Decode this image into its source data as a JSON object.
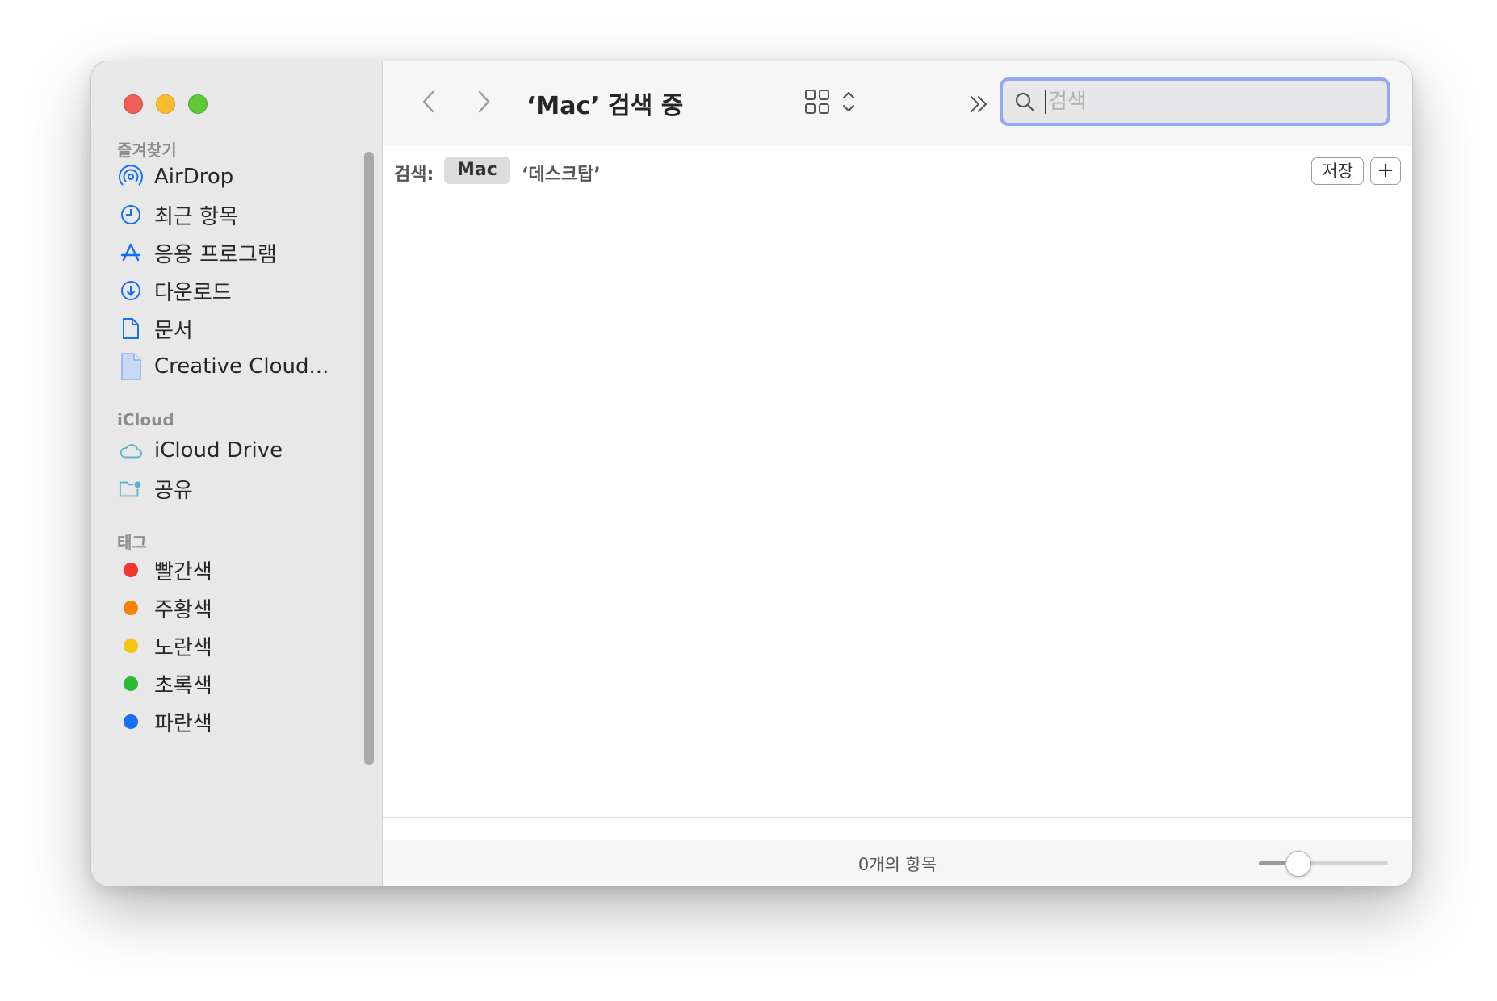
{
  "window": {
    "title": "‘Mac’ 검색 중"
  },
  "sidebar": {
    "favorites_title": "즐겨찾기",
    "favorites": [
      {
        "label": "AirDrop",
        "icon": "airdrop-icon"
      },
      {
        "label": "최근 항목",
        "icon": "clock-icon"
      },
      {
        "label": "응용 프로그램",
        "icon": "applications-icon"
      },
      {
        "label": "다운로드",
        "icon": "download-icon"
      },
      {
        "label": "문서",
        "icon": "document-icon"
      },
      {
        "label": "Creative Cloud...",
        "icon": "file-icon"
      }
    ],
    "icloud_title": "iCloud",
    "icloud": [
      {
        "label": "iCloud Drive",
        "icon": "cloud-icon"
      },
      {
        "label": "공유",
        "icon": "shared-folder-icon"
      }
    ],
    "tags_title": "태그",
    "tags": [
      {
        "label": "빨간색",
        "color": "#f5352c"
      },
      {
        "label": "주황색",
        "color": "#f3830b"
      },
      {
        "label": "노란색",
        "color": "#f5c413"
      },
      {
        "label": "초록색",
        "color": "#2dba33"
      },
      {
        "label": "파란색",
        "color": "#1570f3"
      }
    ]
  },
  "search": {
    "placeholder": "검색",
    "value": ""
  },
  "scope": {
    "label": "검색:",
    "selected": "Mac",
    "other": "‘데스크탑’",
    "save_label": "저장",
    "add_label": "+"
  },
  "status": {
    "item_count": "0개의 항목",
    "zoom_level": 0.25
  },
  "colors": {
    "accent": "#1570f3",
    "search_focus": "#94a9f2"
  }
}
